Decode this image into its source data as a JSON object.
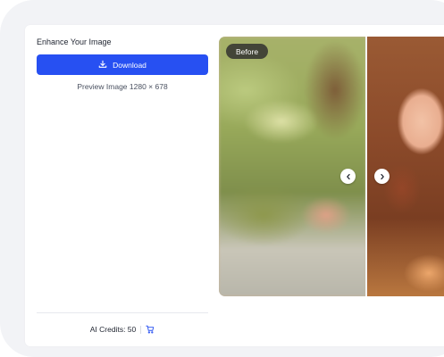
{
  "panel": {
    "title": "Enhance Your Image",
    "download_label": "Download",
    "preview_info": "Preview Image 1280 × 678",
    "credits_label": "AI Credits: 50"
  },
  "viewer": {
    "before_label": "Before"
  },
  "icons": {
    "download": "download-icon",
    "cart": "cart-icon",
    "prev": "chevron-left-icon",
    "next": "chevron-right-icon"
  },
  "colors": {
    "accent": "#2750f2",
    "background": "#f2f3f6"
  }
}
